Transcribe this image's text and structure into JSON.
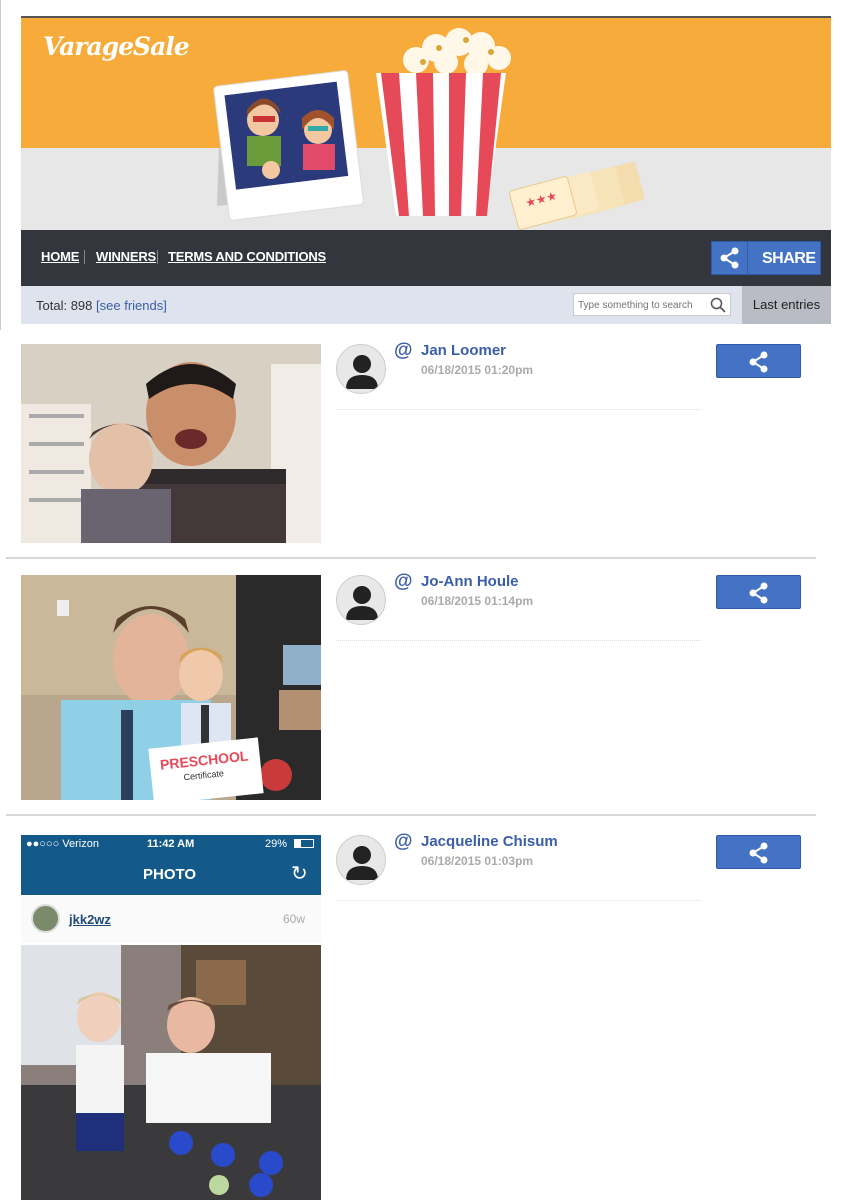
{
  "banner": {
    "logo_text": "VarageSale",
    "background_color": "#f6ab3a"
  },
  "nav": {
    "items": [
      {
        "label": "HOME"
      },
      {
        "label": "WINNERS"
      },
      {
        "label": "TERMS AND CONDITIONS"
      }
    ],
    "share_label": "SHARE",
    "accent_color": "#4472c4"
  },
  "toolbar": {
    "total_label": "Total:",
    "total_count": "898",
    "see_friends": "[see friends]",
    "search_placeholder": "Type something to search",
    "sort_label": "Last entries"
  },
  "entries": [
    {
      "at": "@",
      "name": "Jan Loomer",
      "date": "06/18/2015 01:20pm"
    },
    {
      "at": "@",
      "name": "Jo-Ann Houle",
      "date": "06/18/2015 01:14pm"
    },
    {
      "at": "@",
      "name": "Jacqueline Chisum",
      "date": "06/18/2015 01:03pm"
    }
  ],
  "screenshot_photo": {
    "carrier": "●●○○○ Verizon",
    "time": "11:42 AM",
    "battery": "29%",
    "title": "PHOTO",
    "username": "jkk2wz",
    "age": "60w"
  },
  "certificate": {
    "heading": "PRESCHOOL",
    "subheading": "Certificate"
  }
}
